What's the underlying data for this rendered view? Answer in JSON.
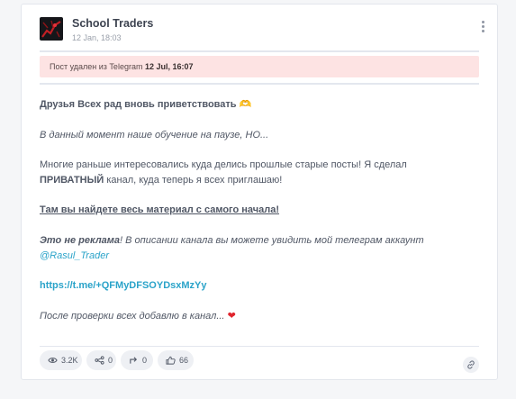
{
  "channel": {
    "name": "School Traders",
    "date": "12 Jan, 18:03"
  },
  "notice": {
    "text": "Пост удален из Telegram",
    "date": "12 Jul, 16:07"
  },
  "post": {
    "line1": "Друзья Всех рад вновь приветствовать",
    "line1_emoji": "🫶",
    "line2": "В данный момент наше обучение на паузе, НО...",
    "line3a": "Многие раньше интересовались куда делись прошлые старые посты! Я сделал",
    "line3b_bold": "ПРИВАТНЫЙ",
    "line3b_rest": " канал, куда теперь я всех приглашаю!",
    "line4": "Там вы найдете весь материал с самого начала!",
    "line5_bold": "Это не реклама",
    "line5_rest": "! В описании канала вы можете увидить мой телеграм аккаунт",
    "mention": "@Rasul_Trader",
    "url": "https://t.me/+QFMyDFSOYDsxMzYy",
    "line7": "После проверки всех добавлю в канал...",
    "line7_emoji": "❤"
  },
  "stats": {
    "views": "3.2K",
    "shares": "0",
    "forwards": "0",
    "reactions": "66"
  },
  "colors": {
    "accent_link": "#2aa3c9",
    "notice_bg": "#fde3e3"
  },
  "icons": [
    "eye-icon",
    "share-icon",
    "forward-icon",
    "thumbs-up-icon",
    "link-icon",
    "more-vertical-icon"
  ]
}
